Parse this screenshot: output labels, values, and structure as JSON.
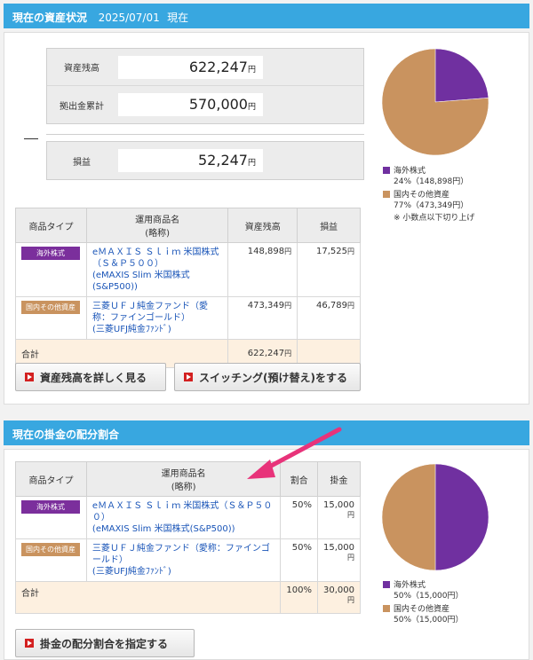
{
  "asset_section": {
    "title": "現在の資産状況",
    "date": "2025/07/01",
    "date_suffix": "現在",
    "summary": {
      "balance_label": "資産残高",
      "balance_value": "622,247",
      "contrib_label": "拠出金累計",
      "contrib_value": "570,000",
      "pnl_label": "損益",
      "pnl_value": "52,247",
      "unit": "円"
    },
    "table": {
      "headers": [
        "商品タイプ",
        "運用商品名",
        "(略称)",
        "資産残高",
        "損益"
      ],
      "rows": [
        {
          "type": "海外株式",
          "name": "eＭＡＸＩＳ Ｓｌｉｍ 米国株式（Ｓ＆Ｐ５００）",
          "short": "(eMAXIS Slim 米国株式(S&P500))",
          "balance": "148,898",
          "pnl": "17,525"
        },
        {
          "type": "国内その他資産",
          "name": "三菱ＵＦＪ純金ファンド（愛称：ファインゴールド）",
          "short": "(三菱UFJ純金ﾌｧﾝﾄﾞ)",
          "balance": "473,349",
          "pnl": "46,789"
        }
      ],
      "total_label": "合計",
      "total_balance": "622,247",
      "unit": "円"
    },
    "pie": {
      "slices": [
        {
          "name": "海外株式",
          "pct": 24,
          "amount": "148,898",
          "color": "#7030a0"
        },
        {
          "name": "国内その他資産",
          "pct": 77,
          "amount": "473,349",
          "color": "#c9935f"
        }
      ]
    },
    "legend": {
      "item1_name": "海外株式",
      "item1_detail": "24%（148,898円）",
      "item2_name": "国内その他資産",
      "item2_detail": "77%（473,349円）",
      "note": "※ 小数点以下切り上げ"
    },
    "btn_detail": "資産残高を詳しく見る",
    "btn_switch": "スイッチング(預け替え)をする"
  },
  "contrib_section": {
    "title": "現在の掛金の配分割合",
    "table": {
      "headers": [
        "商品タイプ",
        "運用商品名",
        "(略称)",
        "割合",
        "掛金"
      ],
      "rows": [
        {
          "type": "海外株式",
          "name": "eＭＡＸＩＳ Ｓｌｉｍ 米国株式（Ｓ＆Ｐ５００）",
          "short": "(eMAXIS Slim 米国株式(S&P500))",
          "ratio": "50%",
          "amount": "15,000"
        },
        {
          "type": "国内その他資産",
          "name": "三菱ＵＦＪ純金ファンド（愛称：ファインゴールド）",
          "short": "(三菱UFJ純金ﾌｧﾝﾄﾞ)",
          "ratio": "50%",
          "amount": "15,000"
        }
      ],
      "total_label": "合計",
      "total_ratio": "100%",
      "total_amount": "30,000",
      "unit": "円"
    },
    "pie": {
      "slices": [
        {
          "name": "海外株式",
          "pct": 50,
          "amount": "15,000",
          "color": "#7030a0"
        },
        {
          "name": "国内その他資産",
          "pct": 50,
          "amount": "15,000",
          "color": "#c9935f"
        }
      ]
    },
    "legend": {
      "item1_name": "海外株式",
      "item1_detail": "50%（15,000円）",
      "item2_name": "国内その他資産",
      "item2_detail": "50%（15,000円）"
    },
    "btn_set": "掛金の配分割合を指定する"
  },
  "colors": {
    "header": "#38a7e0",
    "stock": "#7030a0",
    "domestic": "#c9935f",
    "arrow": "#e8337a"
  }
}
